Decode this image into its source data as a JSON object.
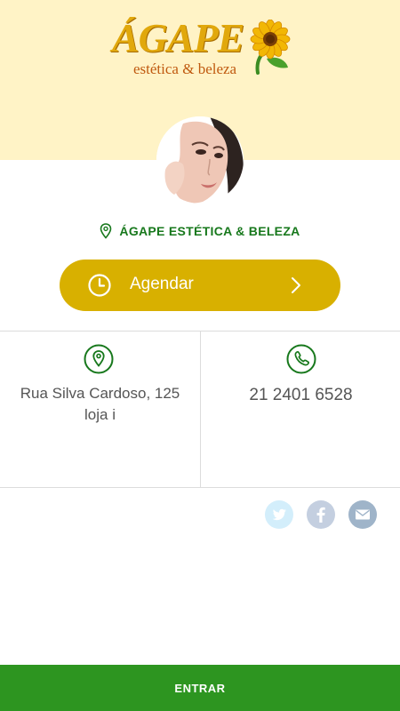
{
  "logo": {
    "word": "ÁGAPE",
    "subtitle": "estética & beleza"
  },
  "business": {
    "name": "ÁGAPE ESTÉTICA & BELEZA"
  },
  "schedule_button": {
    "label": "Agendar"
  },
  "contact": {
    "address": "Rua Silva Cardoso, 125 loja i",
    "phone": "21 2401 6528"
  },
  "social": {
    "icons": [
      "twitter-icon",
      "facebook-icon",
      "email-icon"
    ]
  },
  "footer": {
    "enter_label": "ENTRAR"
  },
  "colors": {
    "hero_background": "#fff3c6",
    "brand_green": "#17781c",
    "cta_yellow": "#d8b000",
    "footer_green": "#2d9520"
  }
}
